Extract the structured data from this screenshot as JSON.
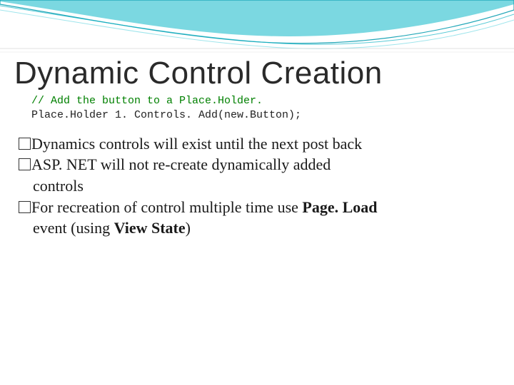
{
  "heading": "Dynamic Control Creation",
  "code": {
    "comment": "// Add the button to a Place.Holder.",
    "line": "Place.Holder 1. Controls. Add(new.Button);"
  },
  "bullets": {
    "b1": "Dynamics controls will exist until the next post back",
    "b2": "ASP. NET will not re-create dynamically added",
    "b2_cont": "controls",
    "b3_a": "For recreation of control multiple time use ",
    "b3_bold1": "Page. Load",
    "b3_cont_a": "event (using ",
    "b3_bold2": "View State",
    "b3_cont_b": ")"
  }
}
